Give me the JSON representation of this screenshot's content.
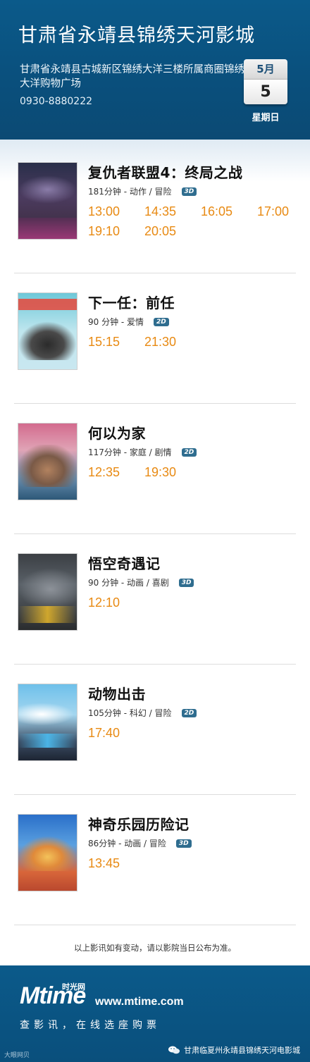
{
  "header": {
    "theater_name": "甘肃省永靖县锦绣天河影城",
    "address": "甘肃省永靖县古城新区锦绣大洋三楼所属商圈锦绣大洋购物广场",
    "phone": "0930-8880222",
    "date": {
      "month": "5月",
      "day": "5",
      "weekday": "星期日"
    }
  },
  "movies": [
    {
      "title": "复仇者联盟4：终局之战",
      "duration": "181分钟 - 动作 / 冒险",
      "format": "3D",
      "times": [
        "13:00",
        "14:35",
        "16:05",
        "17:00",
        "19:10",
        "20:05"
      ]
    },
    {
      "title": "下一任：前任",
      "duration": "90 分钟 - 爱情",
      "format": "2D",
      "times": [
        "15:15",
        "21:30"
      ]
    },
    {
      "title": "何以为家",
      "duration": "117分钟 - 家庭 / 剧情",
      "format": "2D",
      "times": [
        "12:35",
        "19:30"
      ]
    },
    {
      "title": "悟空奇遇记",
      "duration": "90 分钟 - 动画 / 喜剧",
      "format": "3D",
      "times": [
        "12:10"
      ]
    },
    {
      "title": "动物出击",
      "duration": "105分钟 - 科幻 / 冒险",
      "format": "2D",
      "times": [
        "17:40"
      ]
    },
    {
      "title": "神奇乐园历险记",
      "duration": "86分钟 - 动画 / 冒险",
      "format": "3D",
      "times": [
        "13:45"
      ]
    }
  ],
  "notice": "以上影讯如有变动，请以影院当日公布为准。",
  "footer": {
    "logo_text": "Mtime",
    "logo_cn": "时光网",
    "site": "www.mtime.com",
    "slogan": "查影讯，在线选座购票",
    "wechat_account": "甘肃临夏州永靖县锦绣天河电影城",
    "corner_text": "大眼网贝"
  },
  "colors": {
    "header_blue": "#0b5a8a",
    "showtime_orange": "#e88a13",
    "badge_blue": "#2f6d8f"
  }
}
